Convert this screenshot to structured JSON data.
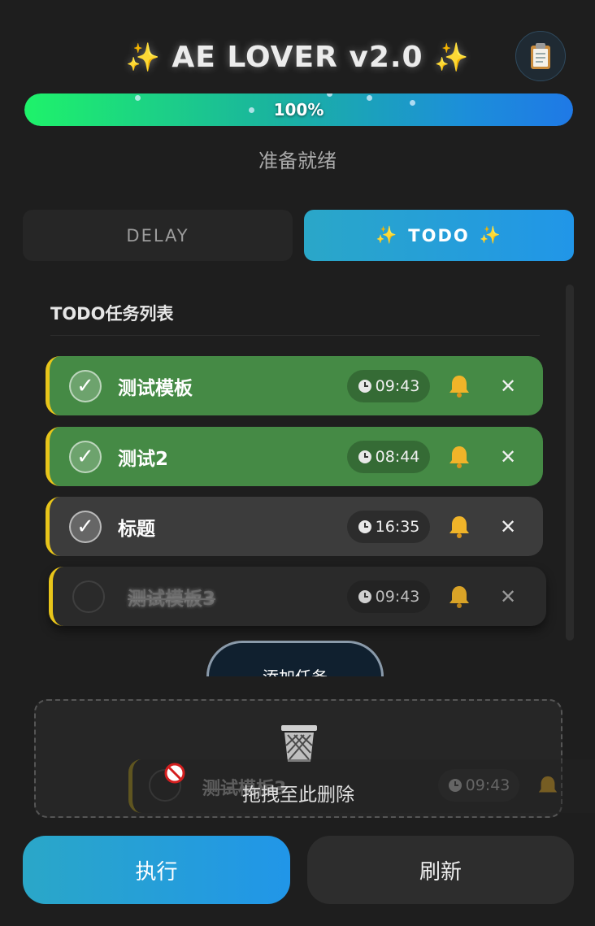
{
  "header": {
    "title_left_sparkle": "✨",
    "title": "AE LOVER v2.0",
    "title_right_sparkle": "✨",
    "clipboard_icon": "clipboard-icon"
  },
  "progress": {
    "value": 100,
    "label": "100%",
    "status": "准备就绪"
  },
  "tabs": [
    {
      "label": "DELAY",
      "active": false
    },
    {
      "label": "TODO",
      "active": true,
      "sparkle_left": "✨",
      "sparkle_right": "✨"
    }
  ],
  "todo": {
    "title": "TODO任务列表",
    "tasks": [
      {
        "title": "测试模板",
        "time": "09:43",
        "state": "done",
        "check": "✓",
        "close": "✕"
      },
      {
        "title": "测试2",
        "time": "08:44",
        "state": "done",
        "check": "✓",
        "close": "✕"
      },
      {
        "title": "标题",
        "time": "16:35",
        "state": "checked",
        "check": "✓",
        "close": "✕"
      },
      {
        "title": "测试模板3",
        "time": "09:43",
        "state": "unchecked",
        "check": "",
        "close": "✕"
      }
    ],
    "add_button": "添加任务"
  },
  "dropzone": {
    "label": "拖拽至此删除",
    "dragged_task": {
      "title": "测试模板3",
      "time": "09:43"
    }
  },
  "actions": {
    "execute": "执行",
    "refresh": "刷新"
  },
  "colors": {
    "accent": "#2196e8",
    "done_task": "#458a45",
    "task_border": "#e8c51a",
    "bell": "#f0b429"
  }
}
